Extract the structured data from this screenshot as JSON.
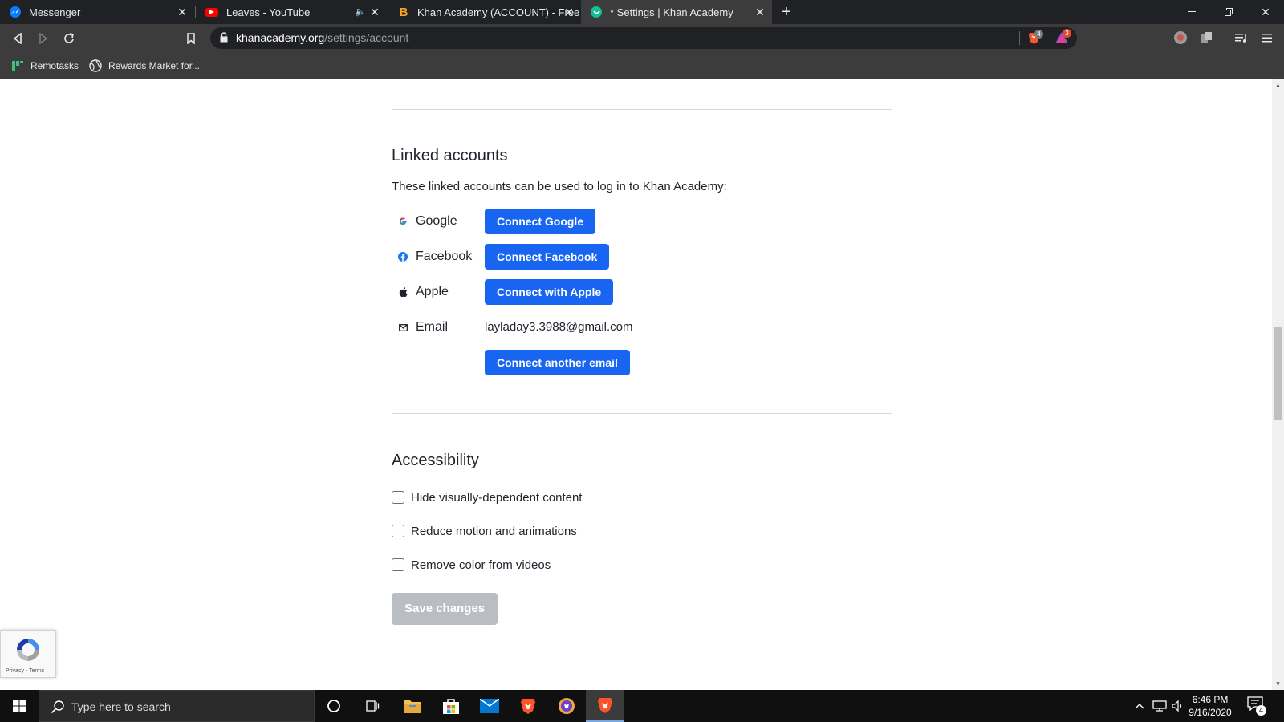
{
  "browser": {
    "tabs": [
      {
        "title": "Messenger",
        "favicon": "messenger-icon",
        "active": false
      },
      {
        "title": "Leaves - YouTube",
        "favicon": "youtube-icon",
        "active": false,
        "audio": true
      },
      {
        "title": "Khan Academy (ACCOUNT) - Free",
        "favicon": "brave-b-icon",
        "active": false
      },
      {
        "title": "* Settings | Khan Academy",
        "favicon": "khan-academy-icon",
        "active": true
      }
    ],
    "address": {
      "domain": "khanacademy.org",
      "path": "/settings/account"
    },
    "shield_count": "4",
    "rewards_count": "3",
    "bookmarks": [
      {
        "label": "Remotasks",
        "icon": "remotasks-icon"
      },
      {
        "label": "Rewards Market for...",
        "icon": "globe-icon"
      }
    ]
  },
  "linked_accounts": {
    "heading": "Linked accounts",
    "description": "These linked accounts can be used to log in to Khan Academy:",
    "providers": [
      {
        "label": "Google",
        "icon": "google-icon",
        "button": "Connect Google"
      },
      {
        "label": "Facebook",
        "icon": "facebook-icon",
        "button": "Connect Facebook"
      },
      {
        "label": "Apple",
        "icon": "apple-icon",
        "button": "Connect with Apple"
      }
    ],
    "email": {
      "label": "Email",
      "icon": "mail-icon",
      "value": "layladay3.3988@gmail.com",
      "button": "Connect another email"
    }
  },
  "accessibility": {
    "heading": "Accessibility",
    "options": [
      {
        "label": "Hide visually-dependent content",
        "checked": false
      },
      {
        "label": "Reduce motion and animations",
        "checked": false
      },
      {
        "label": "Remove color from videos",
        "checked": false
      }
    ],
    "save_button": "Save changes"
  },
  "recaptcha": {
    "links": "Privacy - Terms"
  },
  "taskbar": {
    "search_placeholder": "Type here to search",
    "time": "6:46 PM",
    "date": "9/16/2020",
    "notification_count": "4"
  },
  "colors": {
    "primary_button": "#1865f2",
    "disabled_button": "#babec2",
    "browser_chrome": "#3c3c3c"
  }
}
